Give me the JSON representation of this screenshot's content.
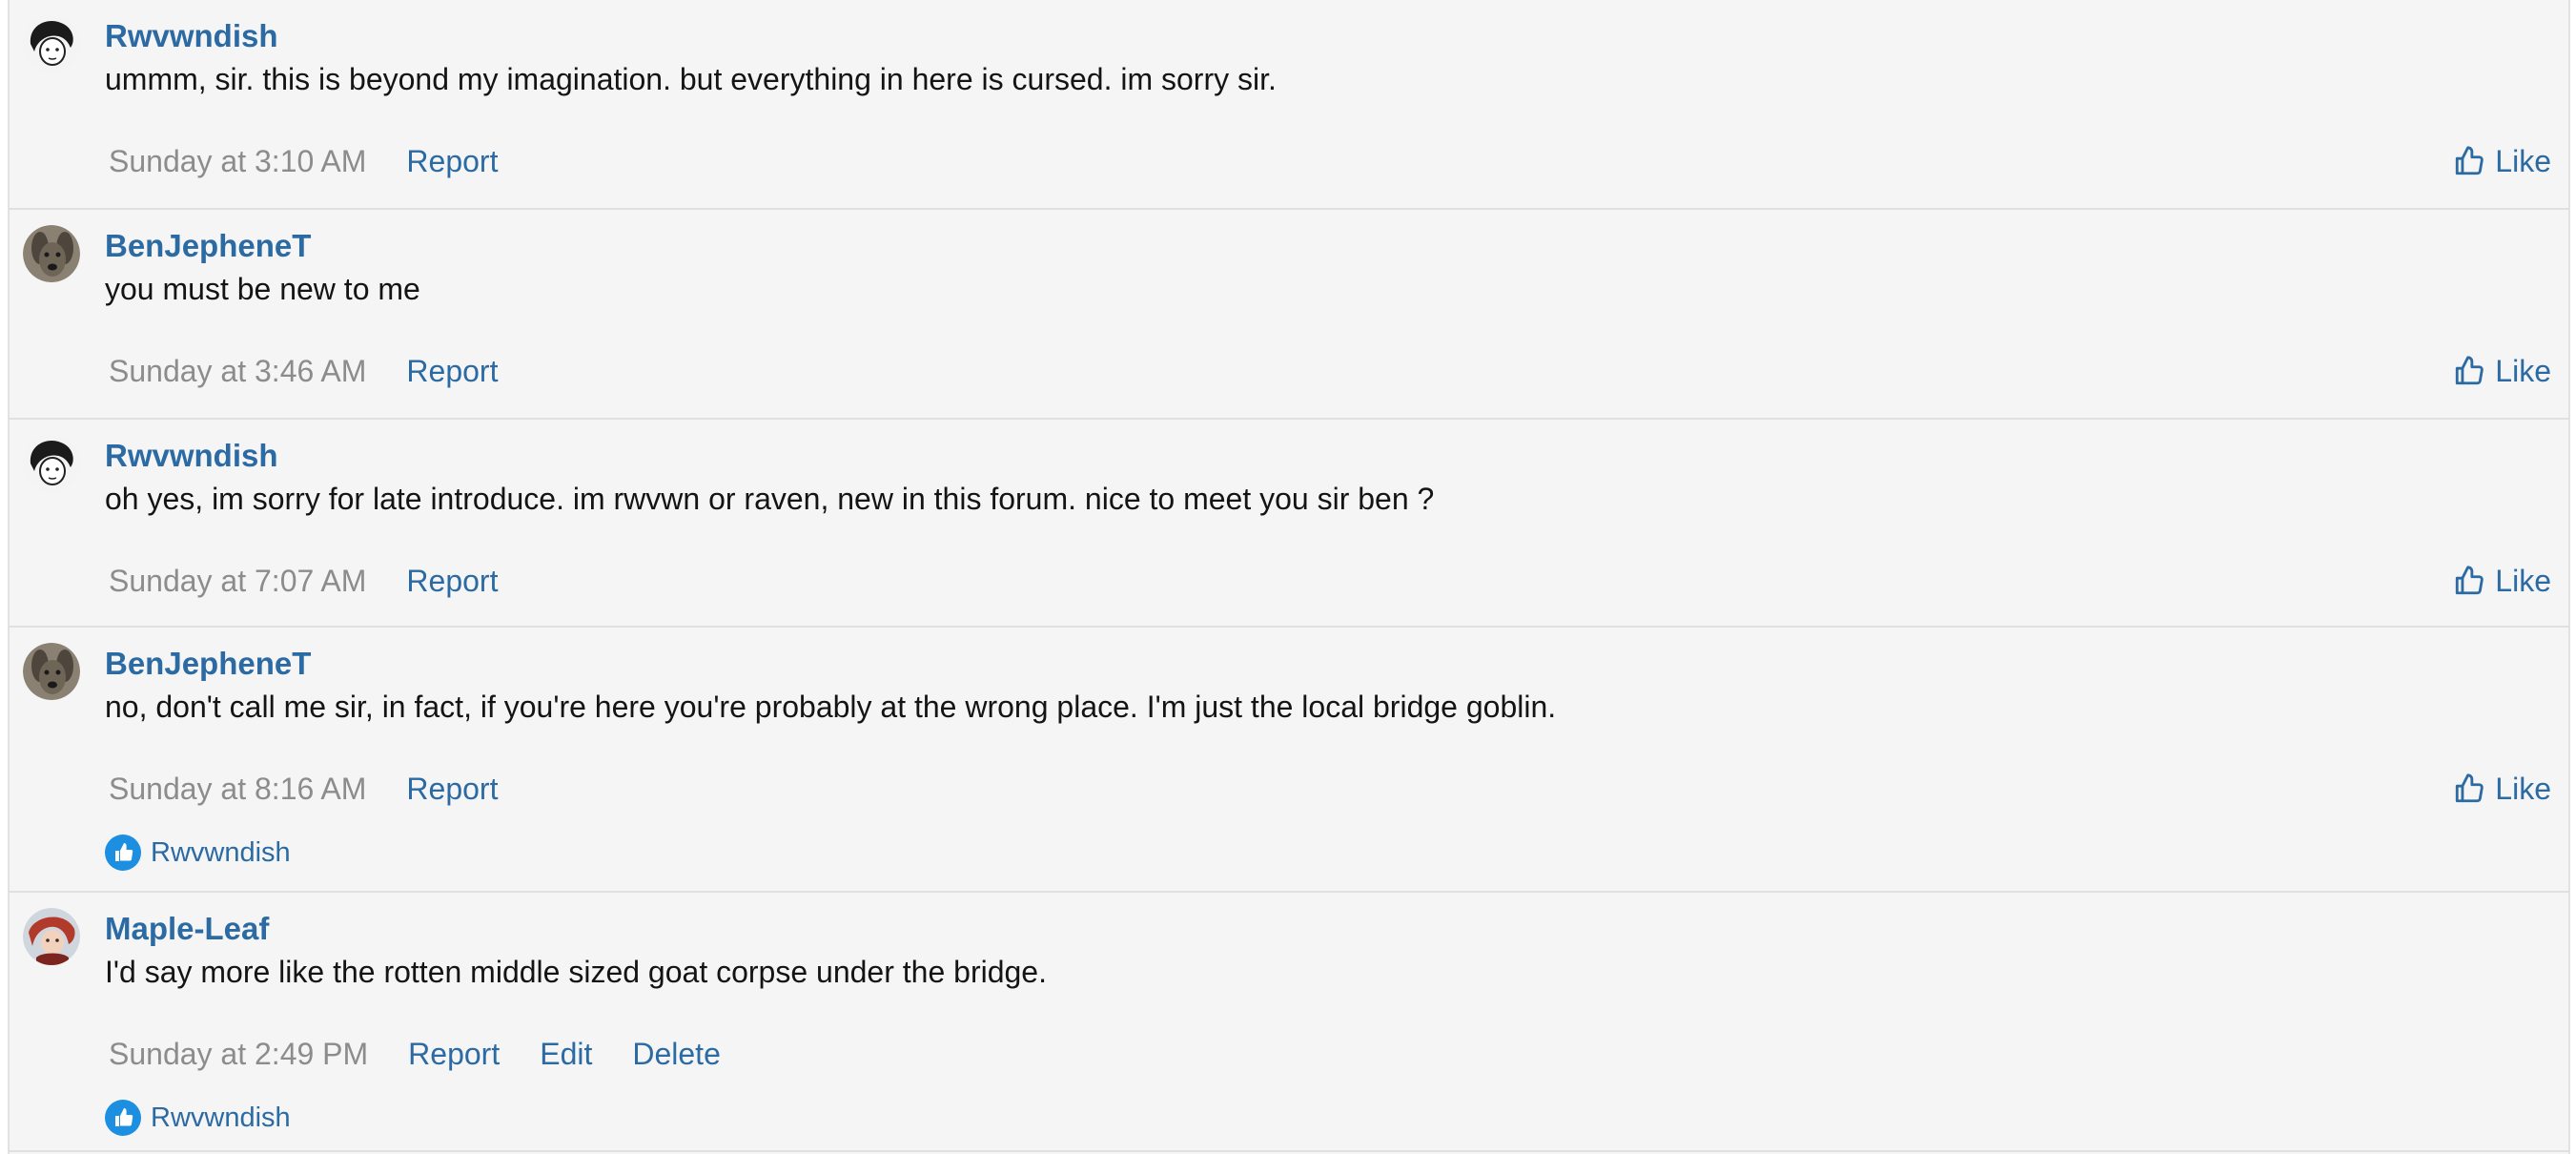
{
  "colors": {
    "accent": "#2b6aa3",
    "muted": "#8c8c8c",
    "background": "#f5f5f5",
    "reaction": "#1c8fe0"
  },
  "comments": [
    {
      "username": "Rwvwndish",
      "avatar": "sketch-face-avatar",
      "message": "ummm, sir. this is beyond my imagination. but everything in here is cursed. im sorry sir.",
      "time": "Sunday at 3:10 AM",
      "actions": [
        "Report"
      ],
      "like_label": "Like"
    },
    {
      "username": "BenJepheneT",
      "avatar": "dog-photo-avatar",
      "message": "you must be new to me",
      "time": "Sunday at 3:46 AM",
      "actions": [
        "Report"
      ],
      "like_label": "Like"
    },
    {
      "username": "Rwvwndish",
      "avatar": "sketch-face-avatar",
      "message": "oh yes, im sorry for late introduce. im rwvwn or raven, new in this forum. nice to meet you sir ben ?",
      "time": "Sunday at 7:07 AM",
      "actions": [
        "Report"
      ],
      "like_label": "Like"
    },
    {
      "username": "BenJepheneT",
      "avatar": "dog-photo-avatar",
      "message": "no, don't call me sir, in fact, if you're here you're probably at the wrong place. I'm just the local bridge goblin.",
      "time": "Sunday at 8:16 AM",
      "actions": [
        "Report"
      ],
      "like_label": "Like",
      "reactions": {
        "icon": "thumbs-up-icon",
        "users": "Rwvwndish"
      }
    },
    {
      "username": "Maple-Leaf",
      "avatar": "anime-character-avatar",
      "message": "I'd say more like the rotten middle sized goat corpse under the bridge.",
      "time": "Sunday at 2:49 PM",
      "actions": [
        "Report",
        "Edit",
        "Delete"
      ],
      "reactions": {
        "icon": "thumbs-up-icon",
        "users": "Rwvwndish"
      }
    }
  ]
}
